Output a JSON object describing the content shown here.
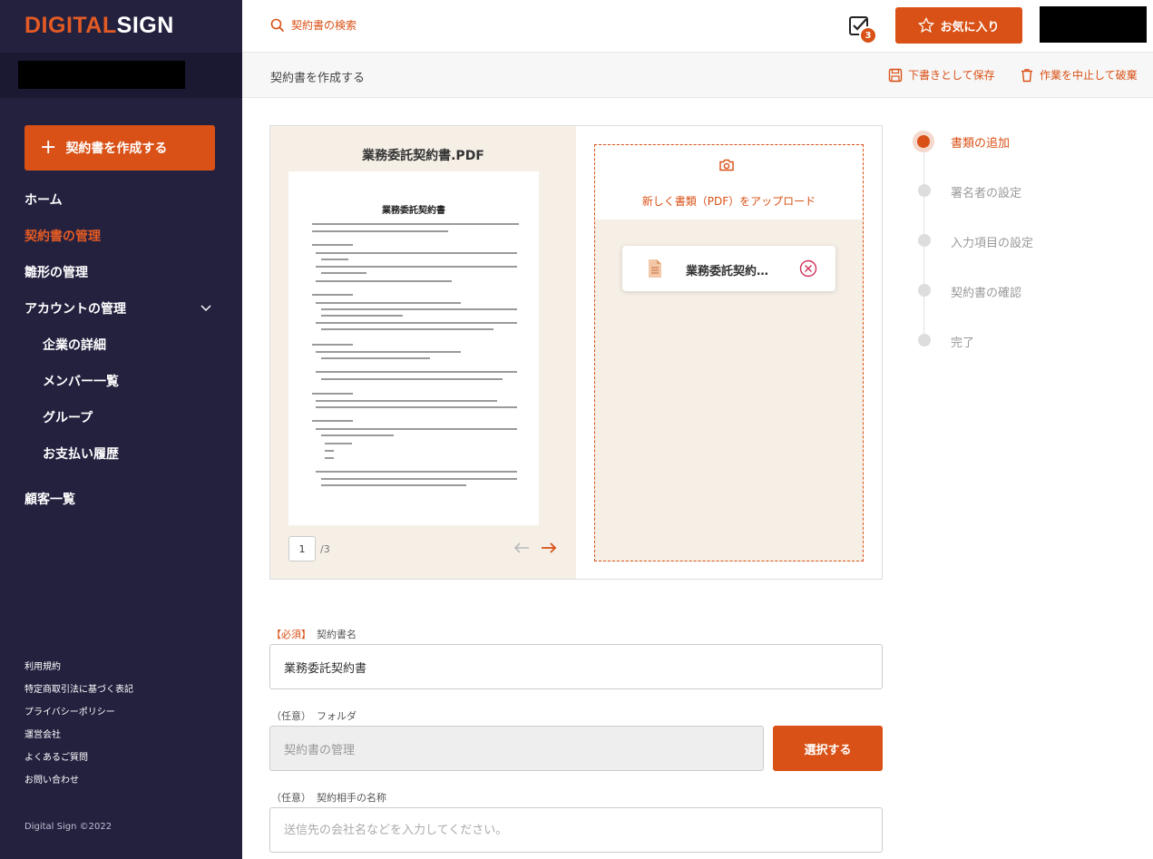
{
  "brand": {
    "logo_part1": "DIGITAL",
    "logo_part2": "SIGN",
    "accent": "#d95116",
    "sidebar_bg": "#24213f"
  },
  "sidebar": {
    "create_label": "契約書を作成する",
    "nav": [
      {
        "label": "ホーム"
      },
      {
        "label": "契約書の管理"
      },
      {
        "label": "雛形の管理"
      },
      {
        "label": "アカウントの管理"
      }
    ],
    "sub_nav": [
      {
        "label": "企業の詳細"
      },
      {
        "label": "メンバー一覧"
      },
      {
        "label": "グループ"
      },
      {
        "label": "お支払い履歴"
      }
    ],
    "customers": "顧客一覧",
    "footer_links": [
      "利用規約",
      "特定商取引法に基づく表記",
      "プライバシーポリシー",
      "運営会社",
      "よくあるご質問",
      "お問い合わせ"
    ],
    "copyright": "Digital Sign ©2022"
  },
  "header": {
    "search_placeholder": "契約書の検索",
    "task_count": "3",
    "favorites_label": "お気に入り"
  },
  "subheader": {
    "title": "契約書を作成する",
    "save_draft": "下書きとして保存",
    "abort": "作業を中止して破棄"
  },
  "preview": {
    "file_title": "業務委託契約書.PDF",
    "doc_heading": "業務委託契約書",
    "page_current": "1",
    "page_total": "/3"
  },
  "upload": {
    "prompt": "新しく書類（PDF）をアップロード",
    "file_name": "業務委託契約…"
  },
  "steps": [
    {
      "label": "書類の追加",
      "active": true
    },
    {
      "label": "署名者の設定",
      "active": false
    },
    {
      "label": "入力項目の設定",
      "active": false
    },
    {
      "label": "契約書の確認",
      "active": false
    },
    {
      "label": "完了",
      "active": false
    }
  ],
  "form": {
    "contract_name": {
      "tag": "【必須】",
      "label": "契約書名",
      "value": "業務委託契約書"
    },
    "folder": {
      "tag": "（任意）",
      "label": "フォルダ",
      "value": "契約書の管理",
      "button": "選択する"
    },
    "counterparty": {
      "tag": "（任意）",
      "label": "契約相手の名称",
      "placeholder": "送信先の会社名などを入力してください。"
    }
  }
}
